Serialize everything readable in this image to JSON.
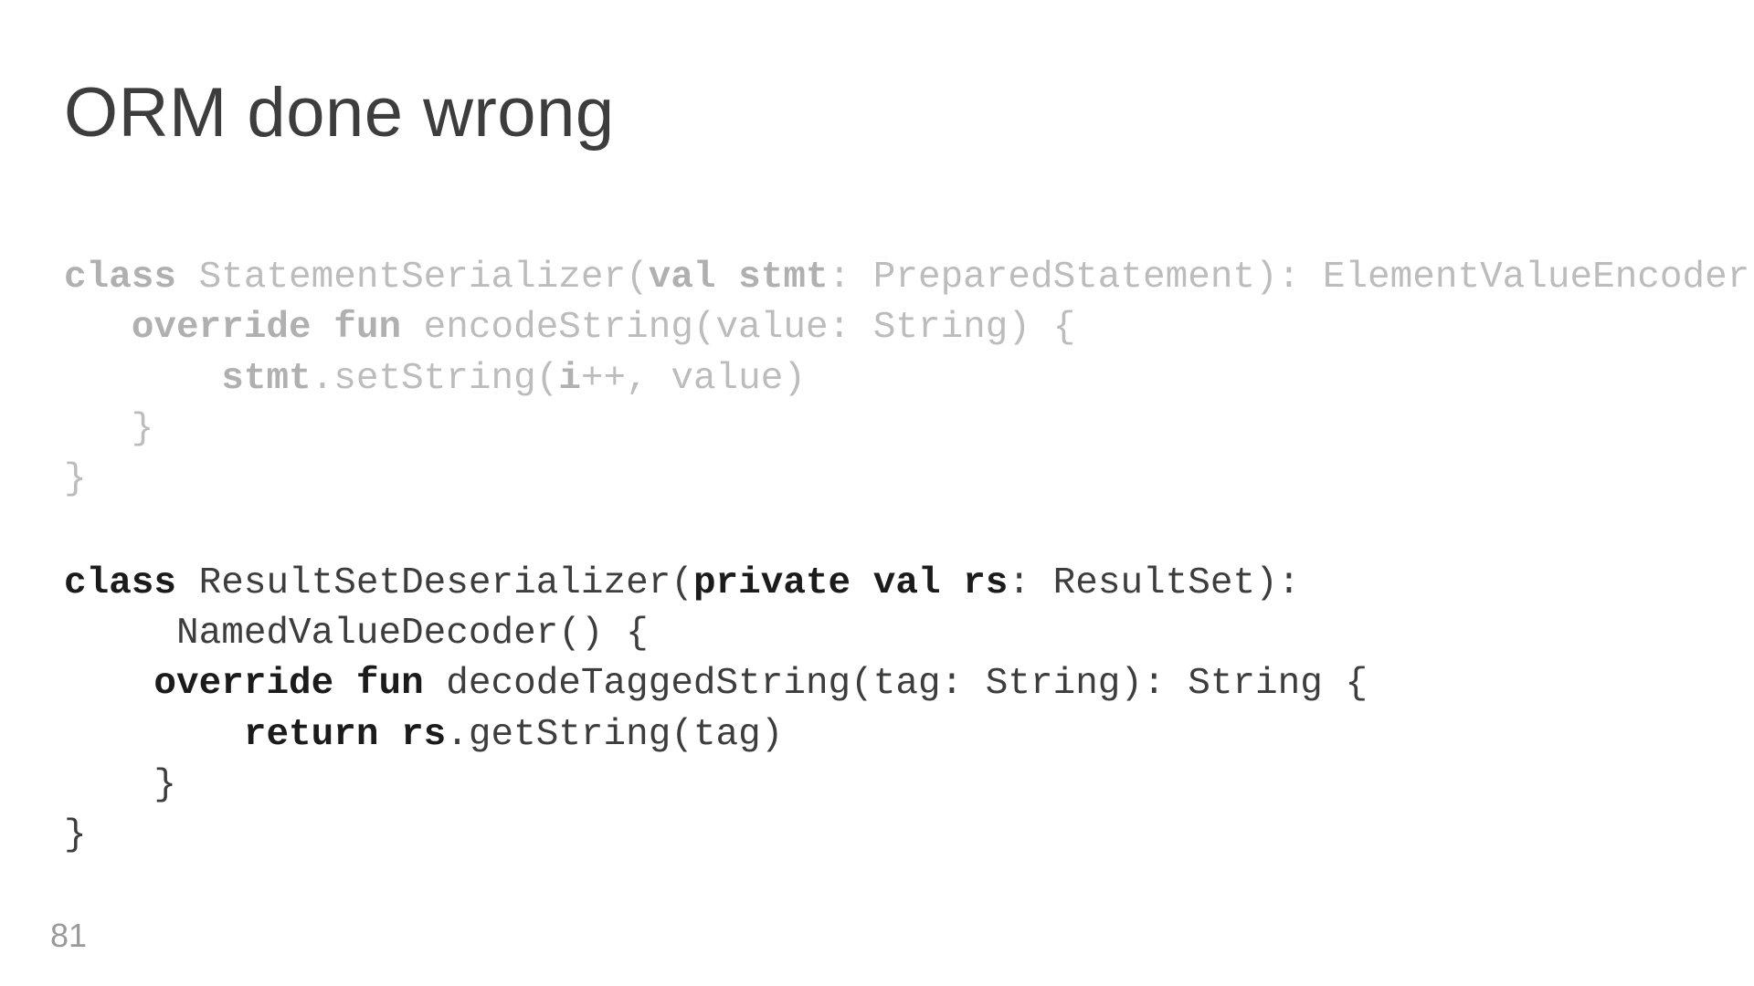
{
  "slide": {
    "title": "ORM done wrong",
    "page_number": "81"
  },
  "code": {
    "block1": {
      "l1_kw1": "class",
      "l1_t1": " StatementSerializer(",
      "l1_kw2": "val",
      "l1_t2": " ",
      "l1_kw3": "stmt",
      "l1_t3": ": PreparedStatement): ElementValueEncoder() {",
      "l2_pad": "   ",
      "l2_kw1": "override",
      "l2_t1": " ",
      "l2_kw2": "fun",
      "l2_t2": " encodeString(value: String) {",
      "l3_pad": "       ",
      "l3_kw1": "stmt",
      "l3_t1": ".setString(",
      "l3_kw2": "i",
      "l3_t2": "++, value)",
      "l4": "   }",
      "l5": "}"
    },
    "block2": {
      "l1_kw1": "class",
      "l1_t1": " ResultSetDeserializer(",
      "l1_kw2": "private",
      "l1_t2": " ",
      "l1_kw3": "val",
      "l1_t3": " ",
      "l1_kw4": "rs",
      "l1_t4": ": ResultSet): ",
      "l2": "     NamedValueDecoder() {",
      "l3_pad": "    ",
      "l3_kw1": "override",
      "l3_t1": " ",
      "l3_kw2": "fun",
      "l3_t2": " decodeTaggedString(tag: String): String {",
      "l4_pad": "        ",
      "l4_kw1": "return",
      "l4_t1": " ",
      "l4_kw2": "rs",
      "l4_t2": ".getString(tag)",
      "l5": "    }",
      "l6": "}"
    }
  }
}
